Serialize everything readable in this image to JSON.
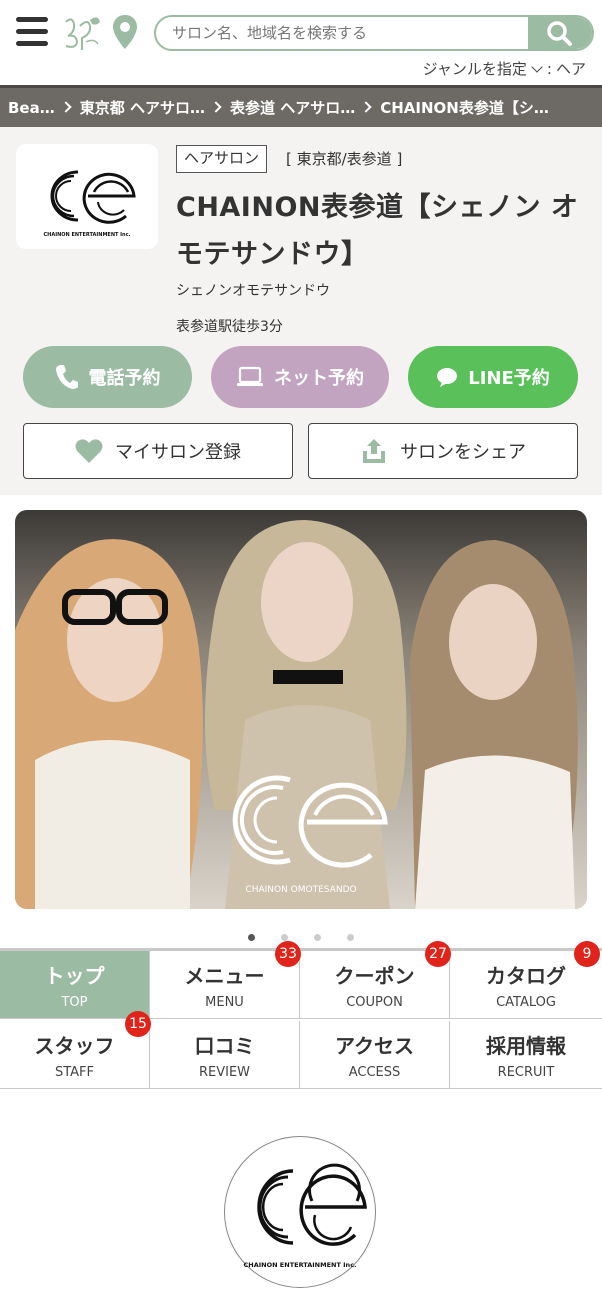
{
  "header": {
    "search_placeholder": "サロン名、地域名を検索する",
    "genre_label": "ジャンルを指定",
    "genre_value": "ヘア"
  },
  "breadcrumb": [
    "Bea…",
    "東京都 ヘアサロ…",
    "表参道 ヘアサロ…",
    "CHAINON表参道【シ…"
  ],
  "salon": {
    "category": "ヘアサロン",
    "area": "[ 東京都/表参道 ]",
    "name": "CHAINON表参道【シェノン オモテサンドウ】",
    "kana": "シェノンオモテサンドウ",
    "access": "表参道駅徒歩3分",
    "logo_text": "CHAINON ENTERTAINMENT Inc."
  },
  "actions": {
    "phone": "電話予約",
    "net": "ネット予約",
    "line": "LINE予約",
    "mysalon": "マイサロン登録",
    "share": "サロンをシェア"
  },
  "hero": {
    "caption": "CHAINON OMOTESANDO",
    "slide_count": 4,
    "active_slide": 1
  },
  "tabs": [
    {
      "jp": "トップ",
      "en": "TOP",
      "badge": ""
    },
    {
      "jp": "メニュー",
      "en": "MENU",
      "badge": "33"
    },
    {
      "jp": "クーポン",
      "en": "COUPON",
      "badge": "27"
    },
    {
      "jp": "カタログ",
      "en": "CATALOG",
      "badge": "9"
    },
    {
      "jp": "スタッフ",
      "en": "STAFF",
      "badge": "15"
    },
    {
      "jp": "口コミ",
      "en": "REVIEW",
      "badge": ""
    },
    {
      "jp": "アクセス",
      "en": "ACCESS",
      "badge": ""
    },
    {
      "jp": "採用情報",
      "en": "RECRUIT",
      "badge": ""
    }
  ],
  "colors": {
    "brand_green": "#9cbba3",
    "net_purple": "#c2a4c0",
    "line_green": "#5ac05a",
    "badge_red": "#e0241b",
    "breadcrumb_bg": "#6d6964"
  },
  "icons": [
    "menu-icon",
    "brand-logo-icon",
    "location-pin-icon",
    "search-icon",
    "phone-icon",
    "laptop-icon",
    "chat-bubble-icon",
    "heart-icon",
    "share-upload-icon"
  ]
}
